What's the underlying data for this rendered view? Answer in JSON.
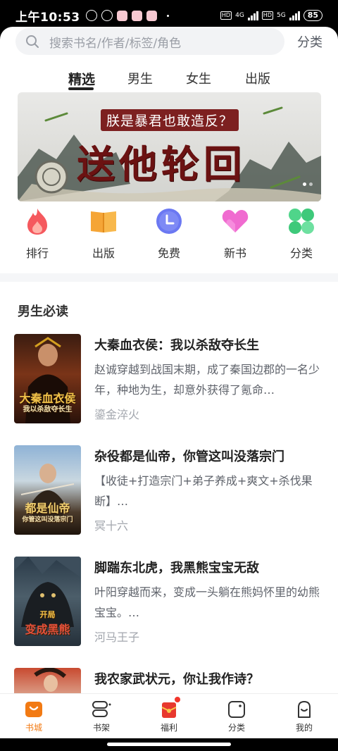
{
  "status_bar": {
    "time": "上午10:53",
    "network_4g": "4G",
    "network_5g": "5G",
    "hd": "HD",
    "battery": "85"
  },
  "search": {
    "placeholder": "搜索书名/作者/标签/角色",
    "category_label": "分类"
  },
  "tabs": [
    {
      "label": "精选",
      "active": true
    },
    {
      "label": "男生",
      "active": false
    },
    {
      "label": "女生",
      "active": false
    },
    {
      "label": "出版",
      "active": false
    }
  ],
  "banner": {
    "subtitle": "朕是暴君也敢造反？",
    "title": "送他轮回"
  },
  "quick_links": [
    {
      "label": "排行",
      "icon": "flame-icon",
      "color": "#f5595e"
    },
    {
      "label": "出版",
      "icon": "book-icon",
      "color": "#f5a536"
    },
    {
      "label": "免费",
      "icon": "clock-icon",
      "color": "#6b78f2"
    },
    {
      "label": "新书",
      "icon": "heart-icon",
      "color": "#f06bd0"
    },
    {
      "label": "分类",
      "icon": "grid-icon",
      "color": "#4fd58a"
    }
  ],
  "section": {
    "title": "男生必读"
  },
  "books": [
    {
      "title": "大秦血衣侯：我以杀敌夺长生",
      "description": "赵诚穿越到战国末期，成了秦国边郡的一名少年，种地为生，却意外获得了氪命…",
      "author": "鎏金淬火",
      "cover_text": "大秦血衣侯",
      "cover_subtext": "我以杀敌夺长生"
    },
    {
      "title": "杂役都是仙帝，你管这叫没落宗门",
      "description": "【收徒+打造宗门+弟子养成+爽文+杀伐果断】…",
      "author": "冥十六",
      "cover_text": "都是仙帝",
      "cover_subtext": "你管这叫没落宗门"
    },
    {
      "title": "脚踹东北虎，我黑熊宝宝无敌",
      "description": "叶阳穿越而来，变成一头躺在熊妈怀里的幼熊宝宝。…",
      "author": "河马王子",
      "cover_text": "变成黑熊",
      "cover_subtext": "开局"
    },
    {
      "title": "我农家武状元，你让我作诗？",
      "description": "",
      "author": "",
      "cover_text": "",
      "cover_subtext": ""
    }
  ],
  "bottom_nav": [
    {
      "label": "书城",
      "icon": "bookstore-icon",
      "active": true
    },
    {
      "label": "书架",
      "icon": "bookshelf-icon",
      "active": false
    },
    {
      "label": "福利",
      "icon": "gift-icon",
      "active": false
    },
    {
      "label": "分类",
      "icon": "category-icon",
      "active": false
    },
    {
      "label": "我的",
      "icon": "profile-icon",
      "active": false
    }
  ],
  "colors": {
    "accent": "#f27a13",
    "text_primary": "#222222",
    "text_secondary": "#5f636b",
    "text_muted": "#a2a6ad"
  }
}
